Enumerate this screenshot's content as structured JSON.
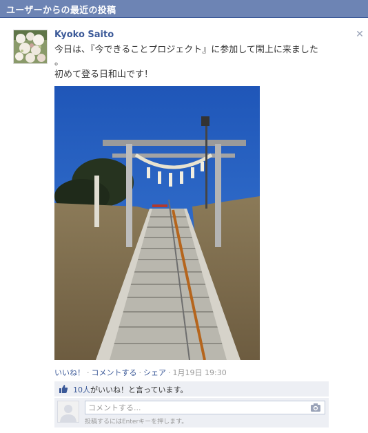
{
  "header": {
    "title": "ユーザーからの最近の投稿"
  },
  "post": {
    "author": "Kyoko Saito",
    "message_line1": "今日は、『今できることプロジェクト』に参加して閑上に来ました",
    "message_line2": "。",
    "message_line3": "初めて登る日和山です！",
    "avatar_icon": "flower-bouquet-photo",
    "photo_subject": "torii-gate-stairway-photo"
  },
  "actions": {
    "like": "いいね！",
    "comment": "コメントする",
    "share": "シェア",
    "separator": "·",
    "timestamp": "1月19日 19:30"
  },
  "likes": {
    "count": "10人",
    "text": "がいいね！と言っています。",
    "icon": "thumbs-up-icon"
  },
  "comment": {
    "placeholder": "コメントする...",
    "hint": "投稿するにはEnterキーを押します。",
    "camera_icon": "camera-icon"
  },
  "colors": {
    "header_bg": "#6d84b4",
    "link": "#3b5998",
    "panel_bg": "#edeff4"
  }
}
